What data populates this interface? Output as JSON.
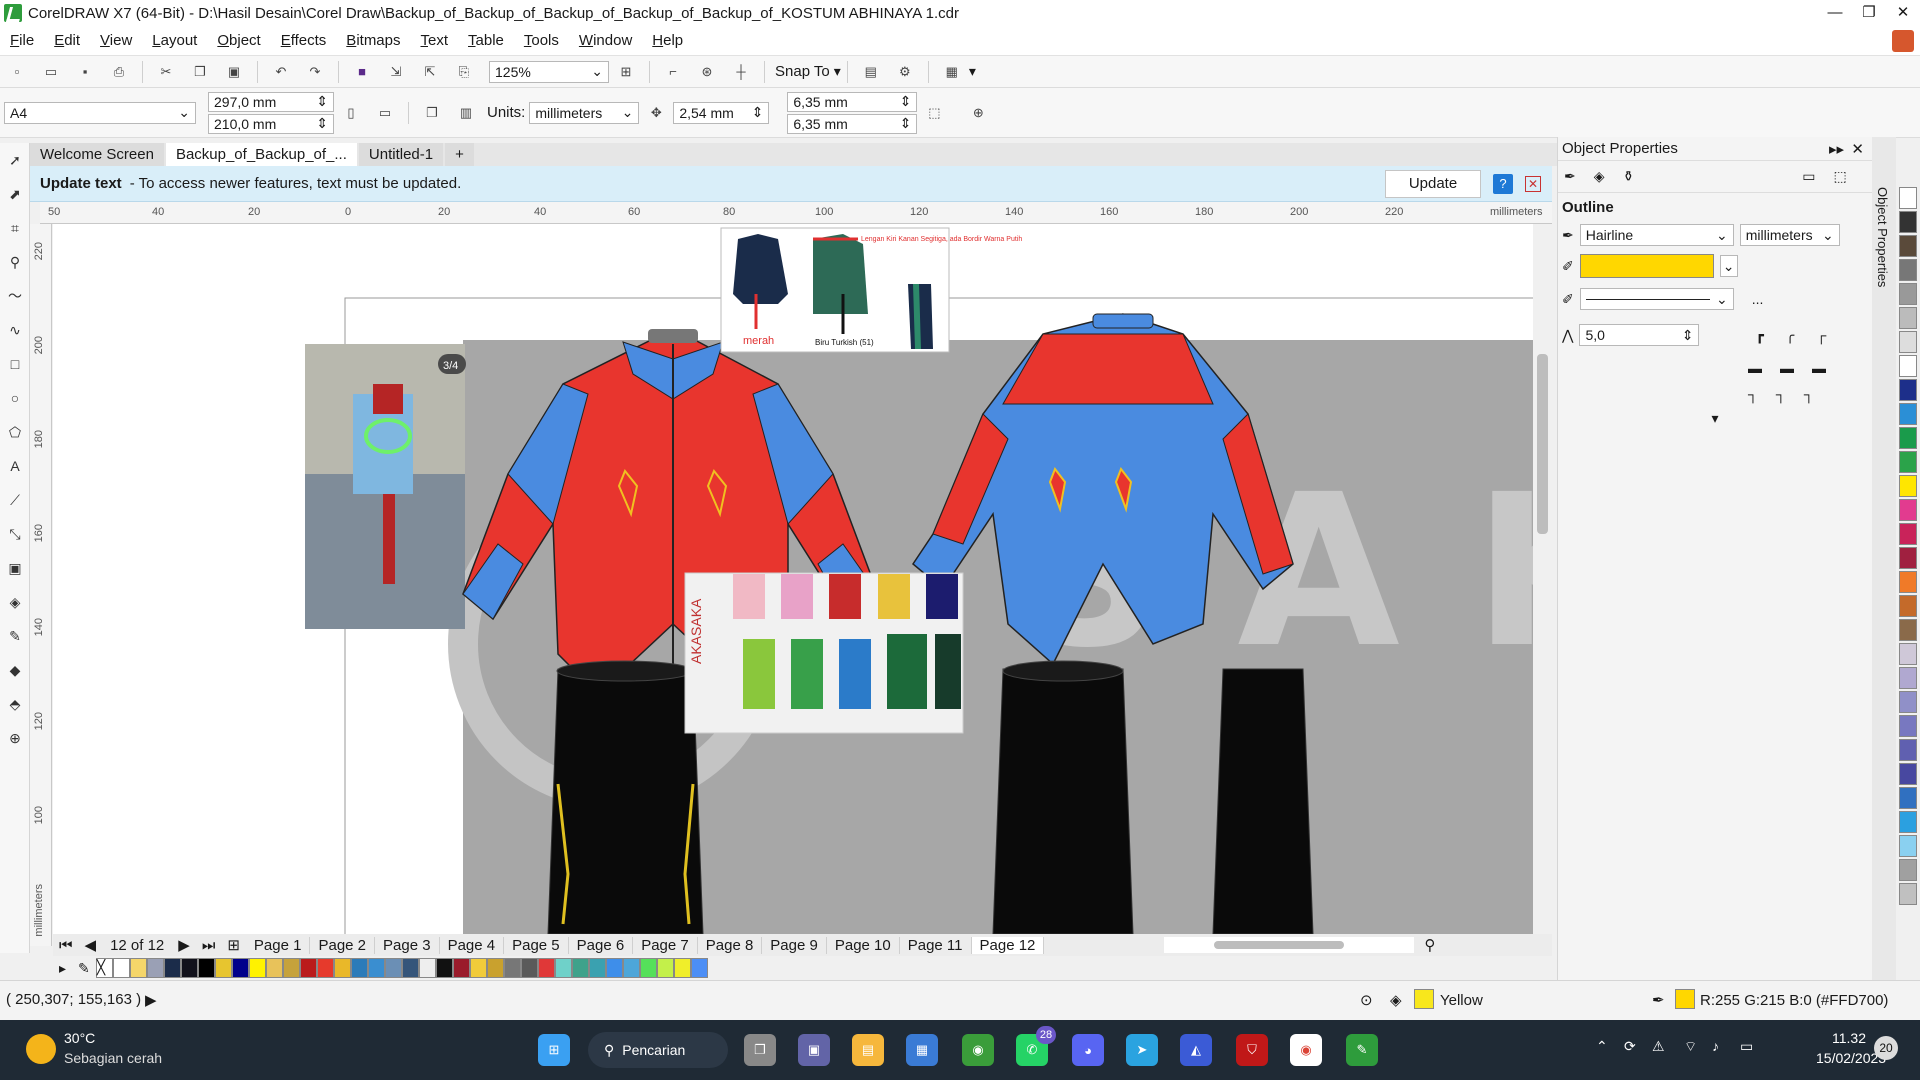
{
  "window": {
    "title": "CorelDRAW X7 (64-Bit) - D:\\Hasil Desain\\Corel Draw\\Backup_of_Backup_of_Backup_of_Backup_of_Backup_of_KOSTUM ABHINAYA 1.cdr",
    "minimize": "—",
    "restore": "❐",
    "close": "✕"
  },
  "menu": [
    "File",
    "Edit",
    "View",
    "Layout",
    "Object",
    "Effects",
    "Bitmaps",
    "Text",
    "Table",
    "Tools",
    "Window",
    "Help"
  ],
  "toolbar": {
    "zoom": "125%",
    "snap_to": "Snap To"
  },
  "property_bar": {
    "page_size": "A4",
    "width": "297,0 mm",
    "height": "210,0 mm",
    "units_label": "Units:",
    "units": "millimeters",
    "nudge": "2,54 mm",
    "dup_x": "6,35 mm",
    "dup_y": "6,35 mm"
  },
  "tabs": [
    "Welcome Screen",
    "Backup_of_Backup_of_...",
    "Untitled-1"
  ],
  "update_bar": {
    "bold": "Update text",
    "message": "- To access newer features, text must be updated.",
    "button": "Update"
  },
  "ruler": {
    "h_ticks": [
      "50",
      "40",
      "20",
      "0",
      "20",
      "40",
      "60",
      "80",
      "100",
      "120",
      "140",
      "160",
      "180",
      "200",
      "220"
    ],
    "h_unit": "millimeters",
    "v_ticks": [
      "220",
      "200",
      "180",
      "160",
      "140",
      "120",
      "100"
    ],
    "v_unit": "millimeters"
  },
  "canvas": {
    "photo_badge": "3/4",
    "ref_note": "Lengan Kiri Kanan Segitiga, ada Bordir Warna Putih",
    "ref_label_red": "merah",
    "ref_label_blue": "Biru Turkish (51)",
    "fabric_brand": "AKASAKA"
  },
  "pages": {
    "counter": "12 of 12",
    "list": [
      "Page 1",
      "Page 2",
      "Page 3",
      "Page 4",
      "Page 5",
      "Page 6",
      "Page 7",
      "Page 8",
      "Page 9",
      "Page 10",
      "Page 11",
      "Page 12"
    ]
  },
  "palette": [
    "#ffffff",
    "#f5d66a",
    "#9aa0b5",
    "#1b2c4a",
    "#11111b",
    "#000000",
    "#e7c52f",
    "#00008b",
    "#fff200",
    "#e8c25a",
    "#c6a23b",
    "#ba1b1b",
    "#e63a2c",
    "#e9b829",
    "#2b7bb9",
    "#3a8ed0",
    "#6b8fb5",
    "#35557a",
    "#eeeeee",
    "#111111",
    "#9a1b2b",
    "#f1cb3a",
    "#c9a12e",
    "#777777",
    "#5a5a5a",
    "#e03838",
    "#6fd1c9",
    "#3fa28b",
    "#3aa1b0",
    "#3e8eea",
    "#4da6d9",
    "#55e05a",
    "#c3f04a",
    "#f0ee2a",
    "#4c8ef5"
  ],
  "status": {
    "coords": "( 250,307; 155,163 )",
    "fill_name": "Yellow",
    "outline_color": "R:255 G:215 B:0 (#FFD700)"
  },
  "docker": {
    "title": "Object Properties",
    "section": "Outline",
    "width": "Hairline",
    "units": "millimeters",
    "color": "#FFD700",
    "miter": "5,0",
    "side_tab": "Object Properties",
    "more": "..."
  },
  "right_palette": [
    "#ffffff",
    "#333333",
    "#5a4a3a",
    "#777777",
    "#999999",
    "#bbbbbb",
    "#dddddd",
    "#ffffff",
    "#1d2f8a",
    "#2b8fd6",
    "#1a9b4b",
    "#2ba34a",
    "#ffe600",
    "#e23b8f",
    "#c9235a",
    "#a02040",
    "#f07a28",
    "#c46a2a",
    "#8a6a4a",
    "#cfc8d8",
    "#b0a8d0",
    "#9090c8",
    "#7878c0",
    "#6060b0",
    "#4848a0",
    "#3070c0",
    "#2ba0e0",
    "#8ad0f0",
    "#a0a0a0",
    "#c0c0c0"
  ],
  "taskbar": {
    "temperature": "30°C",
    "weather": "Sebagian cerah",
    "search": "Pencarian",
    "whatsapp_badge": "28",
    "time": "11.32",
    "date": "15/02/2023",
    "notif": "20"
  }
}
